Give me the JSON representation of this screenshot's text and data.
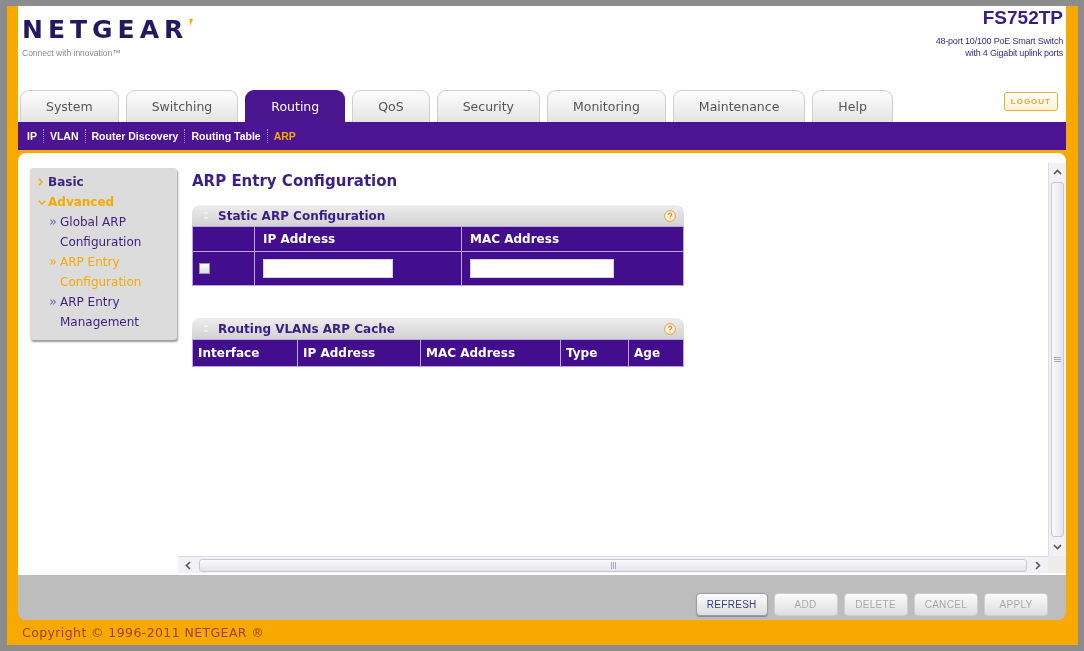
{
  "header": {
    "logo": "NETGEAR",
    "tagline": "Connect with innovation™",
    "model": "FS752TP",
    "model_description": [
      "48-port 10/100 PoE Smart Switch",
      "with 4 Gigabit uplink ports"
    ]
  },
  "tabs": [
    {
      "label": "System",
      "selected": false
    },
    {
      "label": "Switching",
      "selected": false
    },
    {
      "label": "Routing",
      "selected": true
    },
    {
      "label": "QoS",
      "selected": false
    },
    {
      "label": "Security",
      "selected": false
    },
    {
      "label": "Monitoring",
      "selected": false
    },
    {
      "label": "Maintenance",
      "selected": false
    },
    {
      "label": "Help",
      "selected": false
    }
  ],
  "logout_button": {
    "label": "LOGOUT"
  },
  "subnav": [
    {
      "label": "IP",
      "selected": false
    },
    {
      "label": "VLAN",
      "selected": false
    },
    {
      "label": "Router Discovery",
      "selected": false
    },
    {
      "label": "Routing Table",
      "selected": false
    },
    {
      "label": "ARP",
      "selected": true
    }
  ],
  "sidebar": {
    "items": [
      {
        "label": "Basic",
        "expanded": false,
        "selected": false
      },
      {
        "label": "Advanced",
        "expanded": true,
        "selected": true,
        "children": [
          {
            "label": "Global ARP Configuration",
            "selected": false
          },
          {
            "label": "ARP Entry Configuration",
            "selected": true
          },
          {
            "label": "ARP Entry Management",
            "selected": false
          }
        ]
      }
    ]
  },
  "page_title": "ARP Entry Configuration",
  "panels": [
    {
      "kind": "entry",
      "title": "Static ARP Configuration",
      "columns": [
        "IP Address",
        "MAC Address"
      ],
      "rows": [
        {
          "checked": false
        }
      ]
    },
    {
      "kind": "table",
      "title": "Routing VLANs ARP Cache",
      "columns": [
        "Interface",
        "IP Address",
        "MAC Address",
        "Type",
        "Age"
      ]
    }
  ],
  "buttons": [
    {
      "label": "REFRESH",
      "disabled": false
    },
    {
      "label": "ADD",
      "disabled": true
    },
    {
      "label": "DELETE",
      "disabled": true
    },
    {
      "label": "CANCEL",
      "disabled": true
    },
    {
      "label": "APPLY",
      "disabled": true
    }
  ],
  "footer": {
    "copyright": "Copyright © 1996-2011 NETGEAR ®"
  }
}
